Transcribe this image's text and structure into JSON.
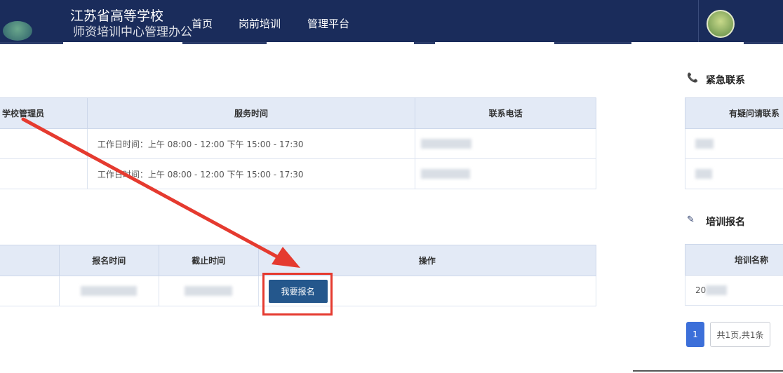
{
  "header": {
    "site_title": "江苏省高等学校",
    "site_subtitle": "师资培训中心管理办公",
    "nav": [
      "首页",
      "岗前培训",
      "管理平台"
    ]
  },
  "contact_table": {
    "headers": [
      "学校管理员",
      "服务时间",
      "联系电话"
    ],
    "rows": [
      {
        "service_time": "工作日时间：上午 08:00 - 12:00 下午 15:00 - 17:30"
      },
      {
        "service_time": "工作日时间：上午 08:00 - 12:00 下午 15:00 - 17:30"
      }
    ]
  },
  "signup_table": {
    "headers": [
      "报名时间",
      "截止时间",
      "操作"
    ],
    "action_button": "我要报名"
  },
  "sidebar": {
    "emergency_title": "紧急联系",
    "emergency_header": "有疑问请联系",
    "training_title": "培训报名",
    "training_header": "培训名称",
    "training_row_prefix": "20",
    "pagination": {
      "current": "1",
      "info": "共1页,共1条"
    }
  },
  "colors": {
    "nav_bg": "#1a2c5b",
    "header_bg": "#e3eaf6",
    "button": "#24578c",
    "annotation": "#e53a2f",
    "page_active": "#3c6fd9"
  },
  "icons": {
    "emergency": "phone-icon",
    "training": "edit-icon"
  }
}
